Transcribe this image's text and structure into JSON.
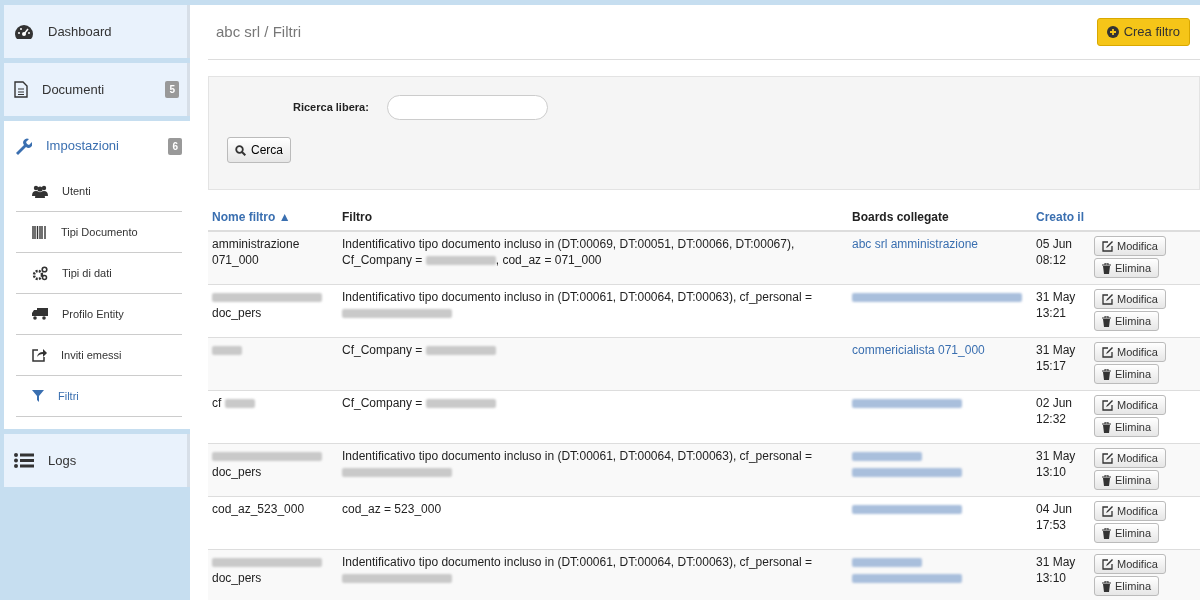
{
  "sidebar": {
    "items": [
      {
        "label": "Dashboard",
        "selected": false
      },
      {
        "label": "Documenti",
        "badge": "5",
        "selected": false
      },
      {
        "label": "Impostazioni",
        "badge": "6",
        "selected": true,
        "expanded": true,
        "children": [
          {
            "label": "Utenti",
            "selected": false
          },
          {
            "label": "Tipi Documento",
            "selected": false
          },
          {
            "label": "Tipi di dati",
            "selected": false
          },
          {
            "label": "Profilo Entity",
            "selected": false
          },
          {
            "label": "Inviti emessi",
            "selected": false
          },
          {
            "label": "Filtri",
            "selected": true
          }
        ]
      },
      {
        "label": "Logs",
        "selected": false
      }
    ]
  },
  "breadcrumb": "abc srl / Filtri",
  "create_button": {
    "label": "Crea filtro"
  },
  "search": {
    "label": "Ricerca libera:",
    "button": "Cerca"
  },
  "table": {
    "columns": [
      {
        "label": "Nome filtro ▲",
        "sortable": true
      },
      {
        "label": "Filtro",
        "sortable": false
      },
      {
        "label": "Boards collegate",
        "sortable": false
      },
      {
        "label": "Creato il",
        "sortable": true
      }
    ],
    "rows": [
      {
        "name": [
          [
            {
              "kind": "text",
              "text": "amministrazione"
            }
          ],
          [
            {
              "kind": "text",
              "text": "071_000"
            }
          ]
        ],
        "filter": [
          {
            "kind": "text",
            "text": "Indentificativo tipo documento incluso in (DT:00069, DT:00051, DT:00066, DT:00067), Cf_Company = "
          },
          {
            "kind": "blur_medium"
          },
          {
            "kind": "text",
            "text": ", cod_az = 071_000"
          }
        ],
        "board": [
          {
            "kind": "text",
            "text": "abc srl amministrazione"
          }
        ],
        "created": [
          "05 Jun",
          "08:12"
        ],
        "edit": "Modifica",
        "delete": "Elimina"
      },
      {
        "name": [
          [
            {
              "kind": "blur_long"
            }
          ],
          [
            {
              "kind": "text",
              "text": "doc_pers"
            }
          ]
        ],
        "filter": [
          {
            "kind": "text",
            "text": "Indentificativo tipo documento incluso in (DT:00061, DT:00064, DT:00063), cf_personal = "
          },
          {
            "kind": "blur_long"
          }
        ],
        "board": [
          {
            "kind": "blur_xlong"
          }
        ],
        "created": [
          "31 May",
          "13:21"
        ],
        "edit": "Modifica",
        "delete": "Elimina"
      },
      {
        "name": [
          [
            {
              "kind": "blur_short"
            }
          ]
        ],
        "filter": [
          {
            "kind": "text",
            "text": "Cf_Company = "
          },
          {
            "kind": "blur_medium"
          }
        ],
        "board": [
          {
            "kind": "text",
            "text": "commericialista 071_000"
          }
        ],
        "created": [
          "31 May",
          "15:17"
        ],
        "edit": "Modifica",
        "delete": "Elimina"
      },
      {
        "name": [
          [
            {
              "kind": "text",
              "text": "cf "
            },
            {
              "kind": "blur_short"
            }
          ]
        ],
        "filter": [
          {
            "kind": "text",
            "text": "Cf_Company = "
          },
          {
            "kind": "blur_medium"
          }
        ],
        "board": [
          {
            "kind": "blur_long"
          }
        ],
        "created": [
          "02 Jun",
          "12:32"
        ],
        "edit": "Modifica",
        "delete": "Elimina"
      },
      {
        "name": [
          [
            {
              "kind": "blur_long"
            }
          ],
          [
            {
              "kind": "text",
              "text": "doc_pers"
            }
          ]
        ],
        "filter": [
          {
            "kind": "text",
            "text": "Indentificativo tipo documento incluso in (DT:00061, DT:00064, DT:00063), cf_personal = "
          },
          {
            "kind": "blur_long"
          }
        ],
        "board": [
          {
            "kind": "blur_medium"
          },
          {
            "kind": "blur_long"
          }
        ],
        "created": [
          "31 May",
          "13:10"
        ],
        "edit": "Modifica",
        "delete": "Elimina"
      },
      {
        "name": [
          [
            {
              "kind": "text",
              "text": "cod_az_523_000"
            }
          ]
        ],
        "filter": [
          {
            "kind": "text",
            "text": "cod_az = 523_000"
          }
        ],
        "board": [
          {
            "kind": "blur_long"
          }
        ],
        "created": [
          "04 Jun",
          "17:53"
        ],
        "edit": "Modifica",
        "delete": "Elimina"
      },
      {
        "name": [
          [
            {
              "kind": "blur_long"
            }
          ],
          [
            {
              "kind": "text",
              "text": "doc_pers"
            }
          ]
        ],
        "filter": [
          {
            "kind": "text",
            "text": "Indentificativo tipo documento incluso in (DT:00061, DT:00064, DT:00063), cf_personal = "
          },
          {
            "kind": "blur_long"
          }
        ],
        "board": [
          {
            "kind": "blur_medium"
          },
          {
            "kind": "blur_long"
          }
        ],
        "created": [
          "31 May",
          "13:10"
        ],
        "edit": "Modifica",
        "delete": "Elimina"
      }
    ]
  }
}
